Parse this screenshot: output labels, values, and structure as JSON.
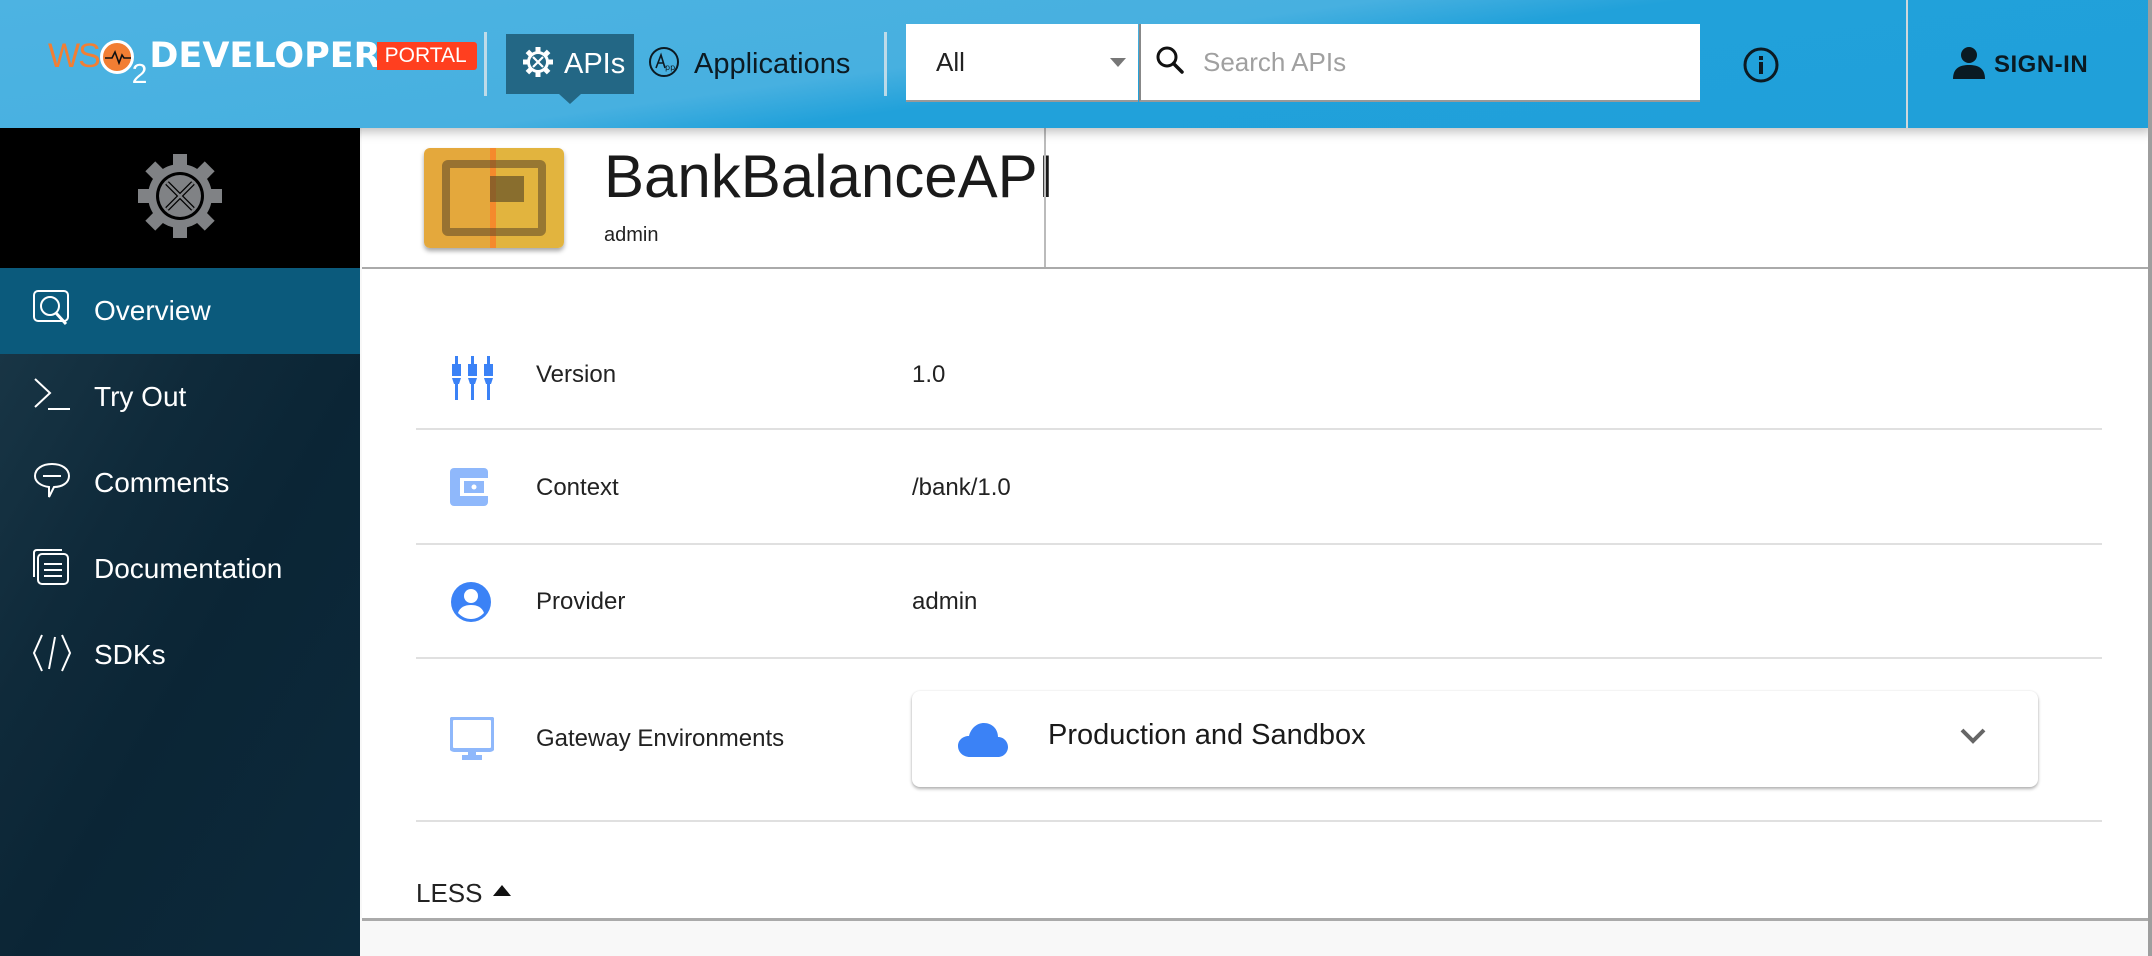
{
  "header": {
    "logo": {
      "wso": "WS",
      "two": "2",
      "developer": "DEVELOPER",
      "portal": "PORTAL"
    },
    "tabs": [
      {
        "label": "APIs",
        "icon": "gear-wrench-icon",
        "active": true
      },
      {
        "label": "Applications",
        "icon": "app-icon",
        "active": false
      }
    ],
    "search": {
      "filter_value": "All",
      "placeholder": "Search APIs",
      "value": ""
    },
    "info_icon": "info-icon",
    "signin_label": "SIGN-IN"
  },
  "sidebar": {
    "hero_icon": "gear-wrench-icon",
    "items": [
      {
        "label": "Overview",
        "icon": "overview-search-icon",
        "active": true
      },
      {
        "label": "Try Out",
        "icon": "terminal-icon",
        "active": false
      },
      {
        "label": "Comments",
        "icon": "comment-icon",
        "active": false
      },
      {
        "label": "Documentation",
        "icon": "documentation-icon",
        "active": false
      },
      {
        "label": "SDKs",
        "icon": "code-icon",
        "active": false
      }
    ]
  },
  "api": {
    "name": "BankBalanceAPI",
    "owner": "admin",
    "details": [
      {
        "key": "Version",
        "value": "1.0",
        "icon": "version-icon"
      },
      {
        "key": "Context",
        "value": "/bank/1.0",
        "icon": "context-icon"
      },
      {
        "key": "Provider",
        "value": "admin",
        "icon": "provider-icon"
      },
      {
        "key": "Gateway Environments",
        "value": "Production and Sandbox",
        "icon": "monitor-icon"
      }
    ],
    "less_label": "LESS"
  },
  "colors": {
    "header_blue": "#20a0d9",
    "active_tab": "#236785",
    "sidebar_active": "#0b5a7c",
    "icon_blue": "#3b82f6",
    "portal_red": "#ff3f1f",
    "logo_orange": "#f27e33"
  }
}
